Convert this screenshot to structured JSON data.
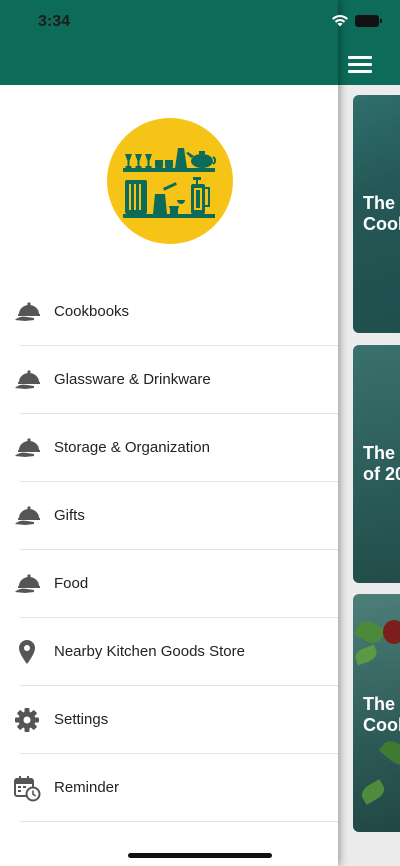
{
  "status_bar": {
    "time": "3:34"
  },
  "colors": {
    "header_green": "#0c6b59",
    "logo_yellow": "#f6c416",
    "icon_gray": "#555555"
  },
  "logo": {
    "icon": "kitchen-shelves-logo"
  },
  "drawer": {
    "items": [
      {
        "label": "Cookbooks",
        "icon": "food-cloche-icon"
      },
      {
        "label": "Glassware & Drinkware",
        "icon": "food-cloche-icon"
      },
      {
        "label": "Storage & Organization",
        "icon": "food-cloche-icon"
      },
      {
        "label": "Gifts",
        "icon": "food-cloche-icon"
      },
      {
        "label": "Food",
        "icon": "food-cloche-icon"
      },
      {
        "label": "Nearby Kitchen Goods Store",
        "icon": "map-pin-icon"
      },
      {
        "label": "Settings",
        "icon": "gear-icon"
      },
      {
        "label": "Reminder",
        "icon": "calendar-clock-icon"
      }
    ]
  },
  "background": {
    "menu_icon": "hamburger-menu-icon",
    "cards": [
      {
        "title_visible": "The \nCook"
      },
      {
        "title_visible": "The \nof 20"
      },
      {
        "title_visible": "The \nCook"
      }
    ]
  }
}
